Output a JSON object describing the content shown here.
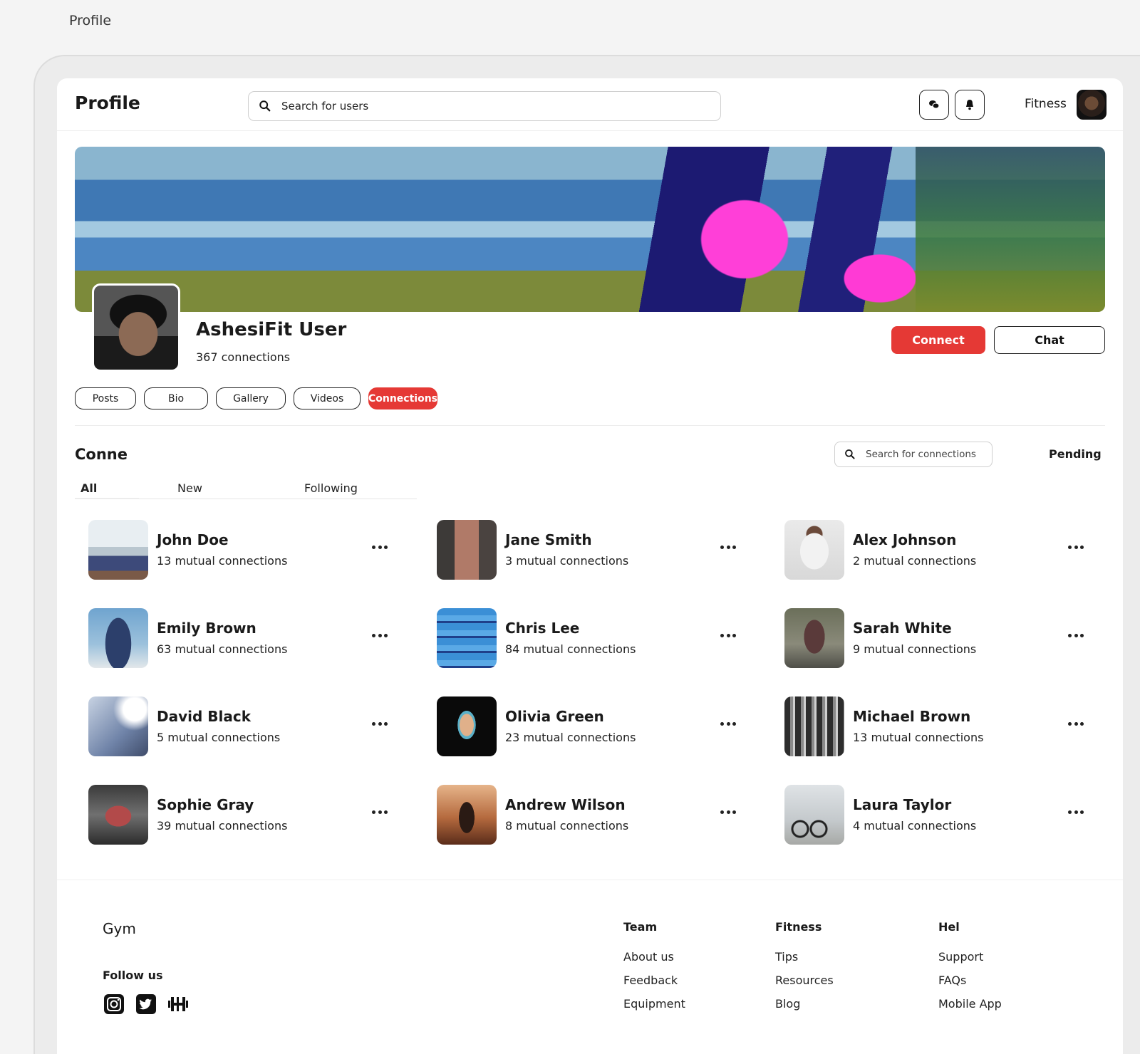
{
  "page_caption": "Profile",
  "header": {
    "title": "Profile",
    "search_placeholder": "Search for users",
    "user_label": "Fitness",
    "icons": [
      "search-icon",
      "chat-icon",
      "bell-icon",
      "avatar"
    ]
  },
  "profile": {
    "name": "AshesiFit User",
    "connections": "367 connections",
    "connect_label": "Connect",
    "chat_label": "Chat"
  },
  "tabs": [
    {
      "label": "Posts",
      "active": false
    },
    {
      "label": "Bio",
      "active": false
    },
    {
      "label": "Gallery",
      "active": false
    },
    {
      "label": "Videos",
      "active": false
    },
    {
      "label": "Connections",
      "active": true
    }
  ],
  "connections": {
    "title": "Conne",
    "search_placeholder": "Search for connections",
    "pending_label": "Pending",
    "filters": [
      {
        "label": "All",
        "active": true
      },
      {
        "label": "New",
        "active": false
      },
      {
        "label": "Following",
        "active": false
      }
    ],
    "people": [
      {
        "name": "John Doe",
        "mutual": "13 mutual connections"
      },
      {
        "name": "Jane Smith",
        "mutual": "3 mutual connections"
      },
      {
        "name": "Alex Johnson",
        "mutual": "2 mutual connections"
      },
      {
        "name": "Emily Brown",
        "mutual": "63 mutual connections"
      },
      {
        "name": "Chris Lee",
        "mutual": "84 mutual connections"
      },
      {
        "name": "Sarah White",
        "mutual": "9 mutual connections"
      },
      {
        "name": "David Black",
        "mutual": "5 mutual connections"
      },
      {
        "name": "Olivia Green",
        "mutual": "23 mutual connections"
      },
      {
        "name": "Michael Brown",
        "mutual": "13 mutual connections"
      },
      {
        "name": "Sophie Gray",
        "mutual": "39 mutual connections"
      },
      {
        "name": "Andrew Wilson",
        "mutual": "8 mutual connections"
      },
      {
        "name": "Laura Taylor",
        "mutual": "4 mutual connections"
      }
    ]
  },
  "footer": {
    "brand": "Gym",
    "follow_title": "Follow us",
    "social_icons": [
      "instagram-icon",
      "twitter-icon",
      "dumbbell-icon"
    ],
    "columns": [
      {
        "title": "Team",
        "links": [
          "About us",
          "Feedback",
          "Equipment"
        ]
      },
      {
        "title": "Fitness",
        "links": [
          "Tips",
          "Resources",
          "Blog"
        ]
      },
      {
        "title": "Hel",
        "links": [
          "Support",
          "FAQs",
          "Mobile App"
        ]
      }
    ]
  },
  "colors": {
    "accent": "#e53935",
    "text": "#1a1a1a",
    "background": "#f4f4f4"
  }
}
